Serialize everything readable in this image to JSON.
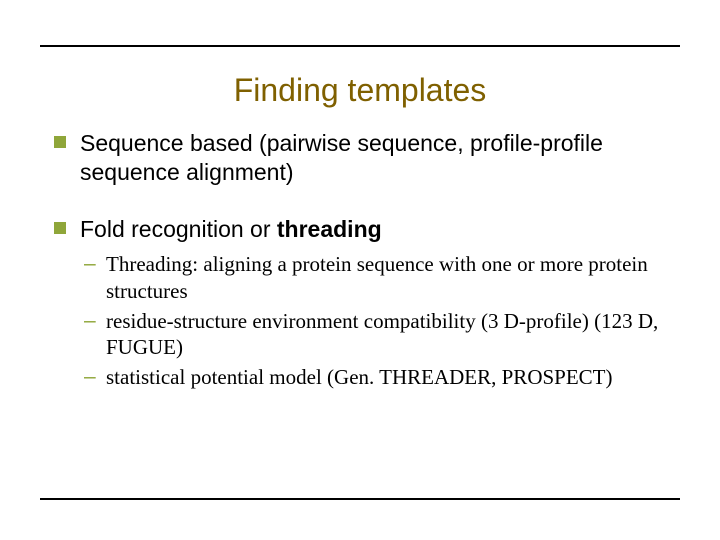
{
  "title": "Finding templates",
  "bullets": [
    {
      "text": "Sequence based (pairwise sequence, profile-profile sequence alignment)",
      "sub": []
    },
    {
      "text_prefix": "Fold recognition or ",
      "text_bold": "threading",
      "sub": [
        "Threading: aligning a protein sequence with one or more protein structures",
        "residue-structure environment compatibility (3 D-profile) (123 D, FUGUE)",
        "statistical potential model (Gen. THREADER, PROSPECT)"
      ]
    }
  ]
}
